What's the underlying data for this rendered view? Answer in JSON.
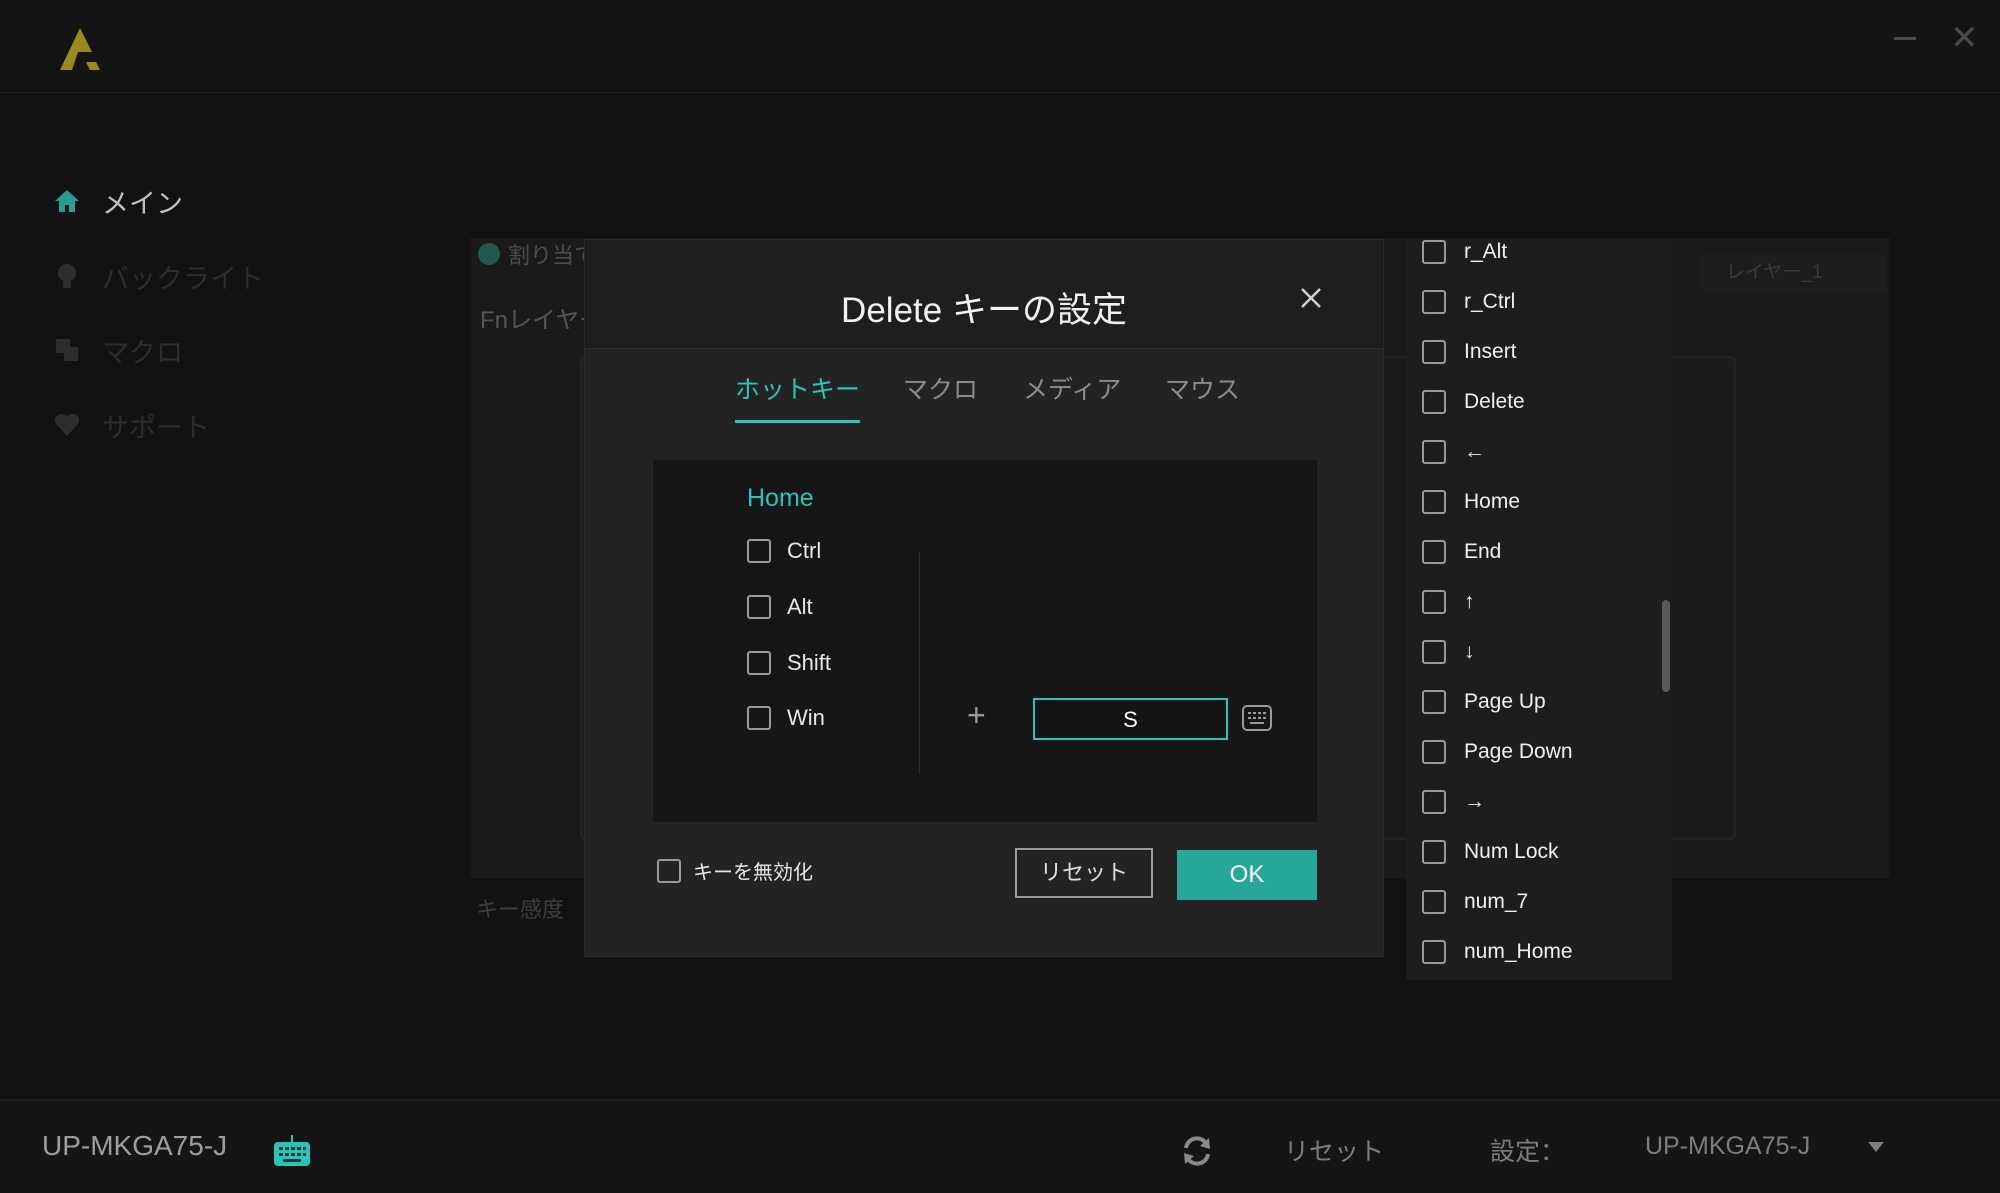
{
  "sidebar": {
    "items": [
      {
        "label": "メイン",
        "icon": "home-icon"
      },
      {
        "label": "バックライト",
        "icon": "bulb-icon"
      },
      {
        "label": "マクロ",
        "icon": "macro-icon"
      },
      {
        "label": "サポート",
        "icon": "heart-icon"
      }
    ]
  },
  "background": {
    "assign_label": "割り当て",
    "fn_layer_label": "Fnレイヤー",
    "key_sensitivity_label": "キー感度",
    "layer_select": "レイヤー_1"
  },
  "dialog": {
    "title": "Delete キーの設定",
    "tabs": [
      "ホットキー",
      "マクロ",
      "メディア",
      "マウス"
    ],
    "active_tab": "ホットキー",
    "selected_key": "Home",
    "modifiers": [
      "Ctrl",
      "Alt",
      "Shift",
      "Win"
    ],
    "plus": "+",
    "key_value": "S",
    "disable_key_label": "キーを無効化",
    "reset_label": "リセット",
    "ok_label": "OK"
  },
  "key_list": [
    "r_Alt",
    "r_Ctrl",
    "Insert",
    "Delete",
    "←",
    "Home",
    "End",
    "↑",
    "↓",
    "Page Up",
    "Page Down",
    "→",
    "Num Lock",
    "num_7",
    "num_Home"
  ],
  "bottom_bar": {
    "device_name": "UP-MKGA75-J",
    "reset_label": "リセット",
    "settings_label": "設定：",
    "profile_value": "UP-MKGA75-J"
  },
  "colors": {
    "accent": "#2bc4b6",
    "ok_button": "#26a79a",
    "background": "#121212",
    "dialog": "#232323"
  }
}
